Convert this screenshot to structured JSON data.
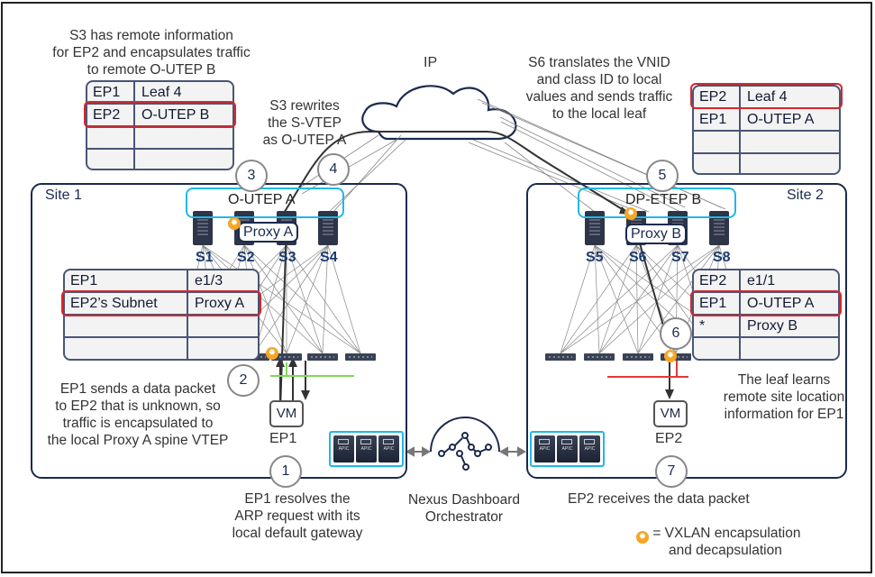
{
  "cloud_label": "IP",
  "annotations": {
    "s3_remote": [
      "S3 has remote information",
      "for EP2 and encapsulates traffic",
      "to remote O-UTEP B"
    ],
    "s3_rewrites": [
      "S3 rewrites",
      "the S-VTEP",
      "as O-UTEP A"
    ],
    "s6_translates": [
      "S6 translates the VNID",
      "and class ID to local",
      "values and sends traffic",
      "to the local leaf"
    ],
    "ep1_sends": [
      "EP1 sends a data packet",
      "to EP2 that is unknown, so",
      "traffic is encapsulated to",
      "the local Proxy A spine VTEP"
    ],
    "ep1_resolves": [
      "EP1 resolves the",
      "ARP request with its",
      "local default gateway"
    ],
    "leaf_learns": [
      "The leaf learns",
      "remote site location",
      "information for EP1"
    ],
    "ep2_receives": "EP2 receives the data packet",
    "legend": [
      "= VXLAN encapsulation",
      "and decapsulation"
    ]
  },
  "tables": {
    "s3_table": [
      [
        "EP1",
        "Leaf 4"
      ],
      [
        "EP2",
        "O-UTEP B"
      ],
      [
        "",
        ""
      ],
      [
        "",
        ""
      ]
    ],
    "s6_table": [
      [
        "EP2",
        "Leaf 4"
      ],
      [
        "EP1",
        "O-UTEP A"
      ],
      [
        "",
        ""
      ],
      [
        "",
        ""
      ]
    ],
    "site1_leaf_table": [
      [
        "EP1",
        "e1/3"
      ],
      [
        "EP2’s Subnet",
        "Proxy A"
      ],
      [
        "",
        ""
      ],
      [
        "",
        ""
      ]
    ],
    "site2_leaf_table": [
      [
        "EP2",
        "e1/1"
      ],
      [
        "EP1",
        "O-UTEP A"
      ],
      [
        "*",
        "Proxy B"
      ],
      [
        "",
        ""
      ]
    ]
  },
  "site1": {
    "label": "Site 1",
    "group": "O-UTEP A",
    "proxy": "Proxy A",
    "spines": [
      "S1",
      "S2",
      "S3",
      "S4"
    ],
    "vm": "VM",
    "endpoint": "EP1"
  },
  "site2": {
    "label": "Site 2",
    "group": "DP-ETEP B",
    "proxy": "Proxy B",
    "spines": [
      "S5",
      "S6",
      "S7",
      "S8"
    ],
    "vm": "VM",
    "endpoint": "EP2"
  },
  "orchestrator": [
    "Nexus Dashboard",
    "Orchestrator"
  ],
  "apic_label": "APIC",
  "steps": [
    "1",
    "2",
    "3",
    "4",
    "5",
    "6",
    "7"
  ],
  "colors": {
    "highlight": "#d9262c",
    "group_border": "#21b8e4",
    "site_border": "#1b2a4e",
    "encap": "#f5a623",
    "site1_link": "#7ed957",
    "site2_link": "#e53935"
  }
}
